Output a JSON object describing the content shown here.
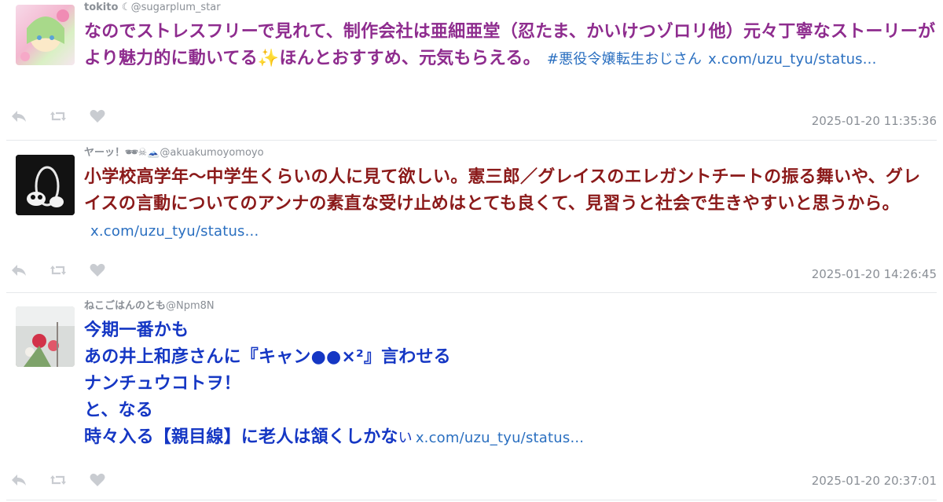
{
  "tweets": [
    {
      "display_name": "tokito ☾",
      "handle": "@sugarplum_star",
      "text": "なのでストレスフリーで見れて、制作会社は亜細亜堂（忍たま、かいけつゾロリ他）元々丁寧なストーリーがより魅力的に動いてる✨ほんとおすすめ、元気もらえる。",
      "hashtag": "#悪役令嬢転生おじさん",
      "link": "x.com/uzu_tyu/status...",
      "timestamp": "2025-01-20 11:35:36",
      "text_color": "#8e2c8e"
    },
    {
      "display_name": "ヤーッ！🕶☠🗻",
      "handle": "@akuakumoyomoyo",
      "text": "小学校高学年〜中学生くらいの人に見て欲しい。憲三郎／グレイスのエレガントチートの振る舞いや、グレイスの言動についてのアンナの素直な受け止めはとても良くて、見習うと社会で生きやすいと思うから。",
      "link": "x.com/uzu_tyu/status...",
      "timestamp": "2025-01-20 14:26:45",
      "text_color": "#8b1a1a"
    },
    {
      "display_name": "ねこごはんのとも",
      "handle": "@Npm8N",
      "lines": [
        "今期一番かも",
        "あの井上和彦さんに『キャン●●×²』言わせる",
        "ナンチュウコトヲ！",
        "と、なる",
        "時々入る【親目線】に老人は頷くしかな"
      ],
      "tail": "い",
      "link": "x.com/uzu_tyu/status...",
      "timestamp": "2025-01-20 20:37:01",
      "text_color": "#1537c4"
    }
  ],
  "icons": [
    "reply-icon",
    "retweet-icon",
    "like-icon"
  ],
  "colors": {
    "meta": "#8a8f96",
    "link": "#2a6fc0",
    "icon": "#c9ccd1",
    "separator": "#e6e8eb"
  }
}
